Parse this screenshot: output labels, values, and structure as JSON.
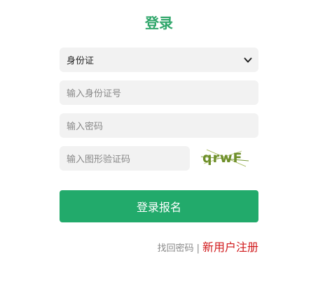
{
  "title": "登录",
  "id_type_select": {
    "value": "身份证"
  },
  "inputs": {
    "id_number_placeholder": "输入身份证号",
    "password_placeholder": "输入密码",
    "captcha_placeholder": "输入图形验证码"
  },
  "captcha": {
    "text": "qrwF"
  },
  "submit_label": "登录报名",
  "links": {
    "forgot_password": "找回密码",
    "separator": "|",
    "register": "新用户注册"
  },
  "colors": {
    "accent_green": "#22aa6b",
    "title_green": "#2fa66a",
    "register_red": "#d0181b"
  }
}
